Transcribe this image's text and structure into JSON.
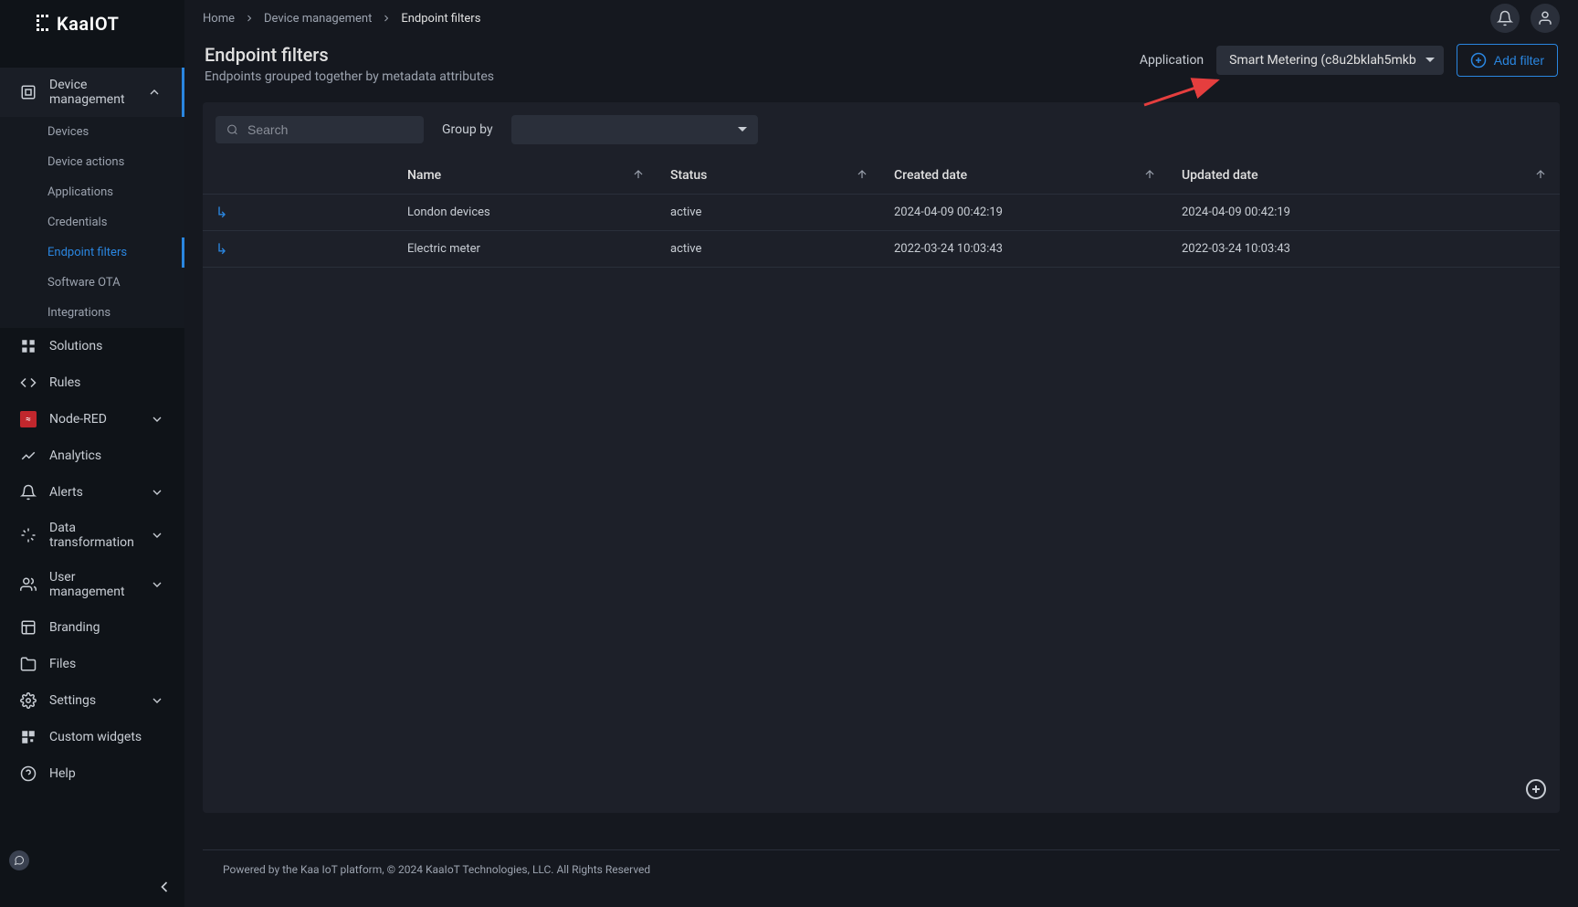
{
  "logo": "KaaIOT",
  "sidebar": {
    "main": [
      {
        "label": "Device management",
        "expandable": true,
        "expanded": true
      },
      {
        "label": "Solutions"
      },
      {
        "label": "Rules"
      },
      {
        "label": "Node-RED",
        "expandable": true
      },
      {
        "label": "Analytics"
      },
      {
        "label": "Alerts",
        "expandable": true
      },
      {
        "label": "Data transformation",
        "expandable": true
      },
      {
        "label": "User management",
        "expandable": true
      },
      {
        "label": "Branding"
      },
      {
        "label": "Files"
      },
      {
        "label": "Settings",
        "expandable": true
      },
      {
        "label": "Custom widgets"
      },
      {
        "label": "Help"
      }
    ],
    "sub": [
      {
        "label": "Devices"
      },
      {
        "label": "Device actions"
      },
      {
        "label": "Applications"
      },
      {
        "label": "Credentials"
      },
      {
        "label": "Endpoint filters",
        "active": true
      },
      {
        "label": "Software OTA"
      },
      {
        "label": "Integrations"
      }
    ]
  },
  "breadcrumb": [
    {
      "label": "Home"
    },
    {
      "label": "Device management"
    },
    {
      "label": "Endpoint filters",
      "current": true
    }
  ],
  "page": {
    "title": "Endpoint filters",
    "subtitle": "Endpoints grouped together by metadata attributes"
  },
  "app_selector": {
    "label": "Application",
    "value": "Smart Metering (c8u2bklah5mkb"
  },
  "add_filter_label": "Add filter",
  "search_placeholder": "Search",
  "group_by_label": "Group by",
  "columns": {
    "name": "Name",
    "status": "Status",
    "created": "Created date",
    "updated": "Updated date"
  },
  "rows": [
    {
      "name": "London devices",
      "status": "active",
      "created": "2024-04-09 00:42:19",
      "updated": "2024-04-09 00:42:19"
    },
    {
      "name": "Electric meter",
      "status": "active",
      "created": "2022-03-24 10:03:43",
      "updated": "2022-03-24 10:03:43"
    }
  ],
  "footer": "Powered by the Kaa IoT platform, © 2024 KaaIoT Technologies, LLC. All Rights Reserved"
}
